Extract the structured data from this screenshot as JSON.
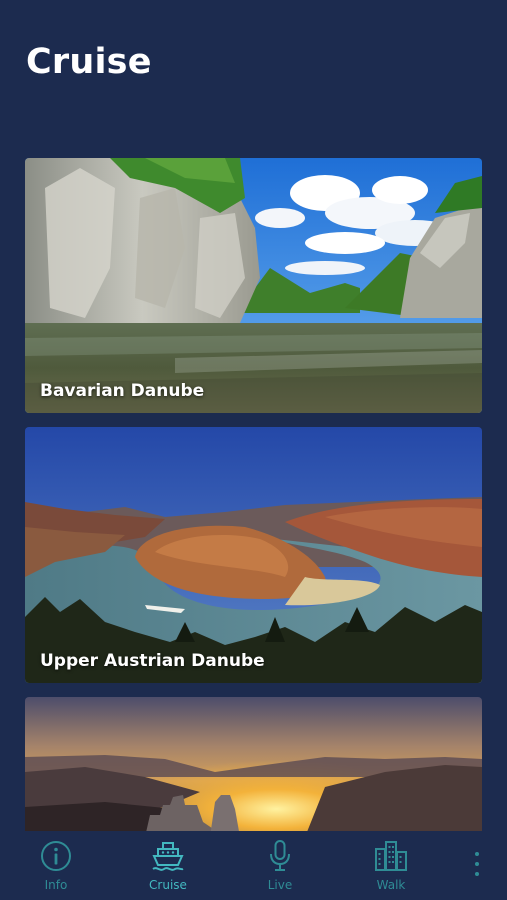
{
  "header": {
    "title": "Cruise"
  },
  "cards": [
    {
      "label": "Bavarian Danube"
    },
    {
      "label": "Upper Austrian Danube"
    },
    {
      "label": ""
    }
  ],
  "bottom_nav": {
    "items": [
      {
        "label": "Info",
        "icon": "info-icon",
        "active": false
      },
      {
        "label": "Cruise",
        "icon": "ship-icon",
        "active": true
      },
      {
        "label": "Live",
        "icon": "microphone-icon",
        "active": false
      },
      {
        "label": "Walk",
        "icon": "city-buildings-icon",
        "active": false
      }
    ],
    "more_icon": "more-vertical-icon"
  },
  "colors": {
    "background": "#1c2b4f",
    "nav_icon": "#2f8c95",
    "nav_active": "#43b8c0",
    "title": "#ffffff"
  }
}
